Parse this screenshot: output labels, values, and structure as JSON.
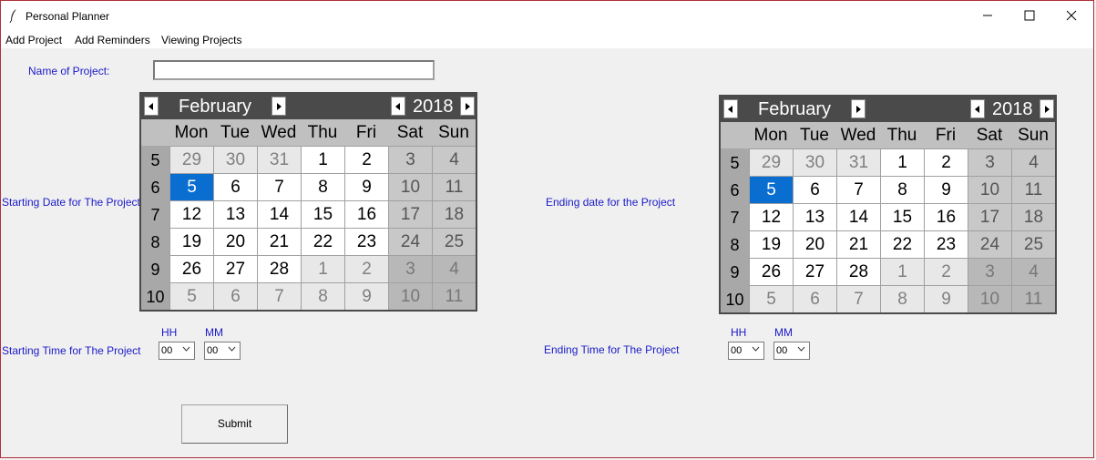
{
  "window": {
    "title": "Personal Planner"
  },
  "menu": [
    "Add Project",
    "Add Reminders",
    "Viewing Projects"
  ],
  "form": {
    "name_label": "Name of Project:",
    "name_value": "",
    "start_date_label": "Starting Date for The Project",
    "end_date_label": "Ending date for the Project",
    "start_time_label": "Starting Time for The Project",
    "end_time_label": "Ending Time for The Project",
    "hh_label": "HH",
    "mm_label": "MM",
    "submit_label": "Submit"
  },
  "time": {
    "start": {
      "hh": "00",
      "mm": "00"
    },
    "end": {
      "hh": "00",
      "mm": "00"
    }
  },
  "calendar_common": {
    "weekdays": [
      "Mon",
      "Tue",
      "Wed",
      "Thu",
      "Fri",
      "Sat",
      "Sun"
    ],
    "weeks": [
      "5",
      "6",
      "7",
      "8",
      "9",
      "10"
    ],
    "days": [
      [
        "29",
        "30",
        "31",
        "1",
        "2",
        "3",
        "4"
      ],
      [
        "5",
        "6",
        "7",
        "8",
        "9",
        "10",
        "11"
      ],
      [
        "12",
        "13",
        "14",
        "15",
        "16",
        "17",
        "18"
      ],
      [
        "19",
        "20",
        "21",
        "22",
        "23",
        "24",
        "25"
      ],
      [
        "26",
        "27",
        "28",
        "1",
        "2",
        "3",
        "4"
      ],
      [
        "5",
        "6",
        "7",
        "8",
        "9",
        "10",
        "11"
      ]
    ],
    "selected_day": "5"
  },
  "start_calendar": {
    "month": "February",
    "year": "2018"
  },
  "end_calendar": {
    "month": "February",
    "year": "2018"
  },
  "colors": {
    "label_blue": "#1a1ac8",
    "header_bg": "#4a4a4a",
    "selected_bg": "#0a6ed1",
    "weekend_bg": "#c8c8c8",
    "other_month_bg": "#e8e8e8"
  }
}
